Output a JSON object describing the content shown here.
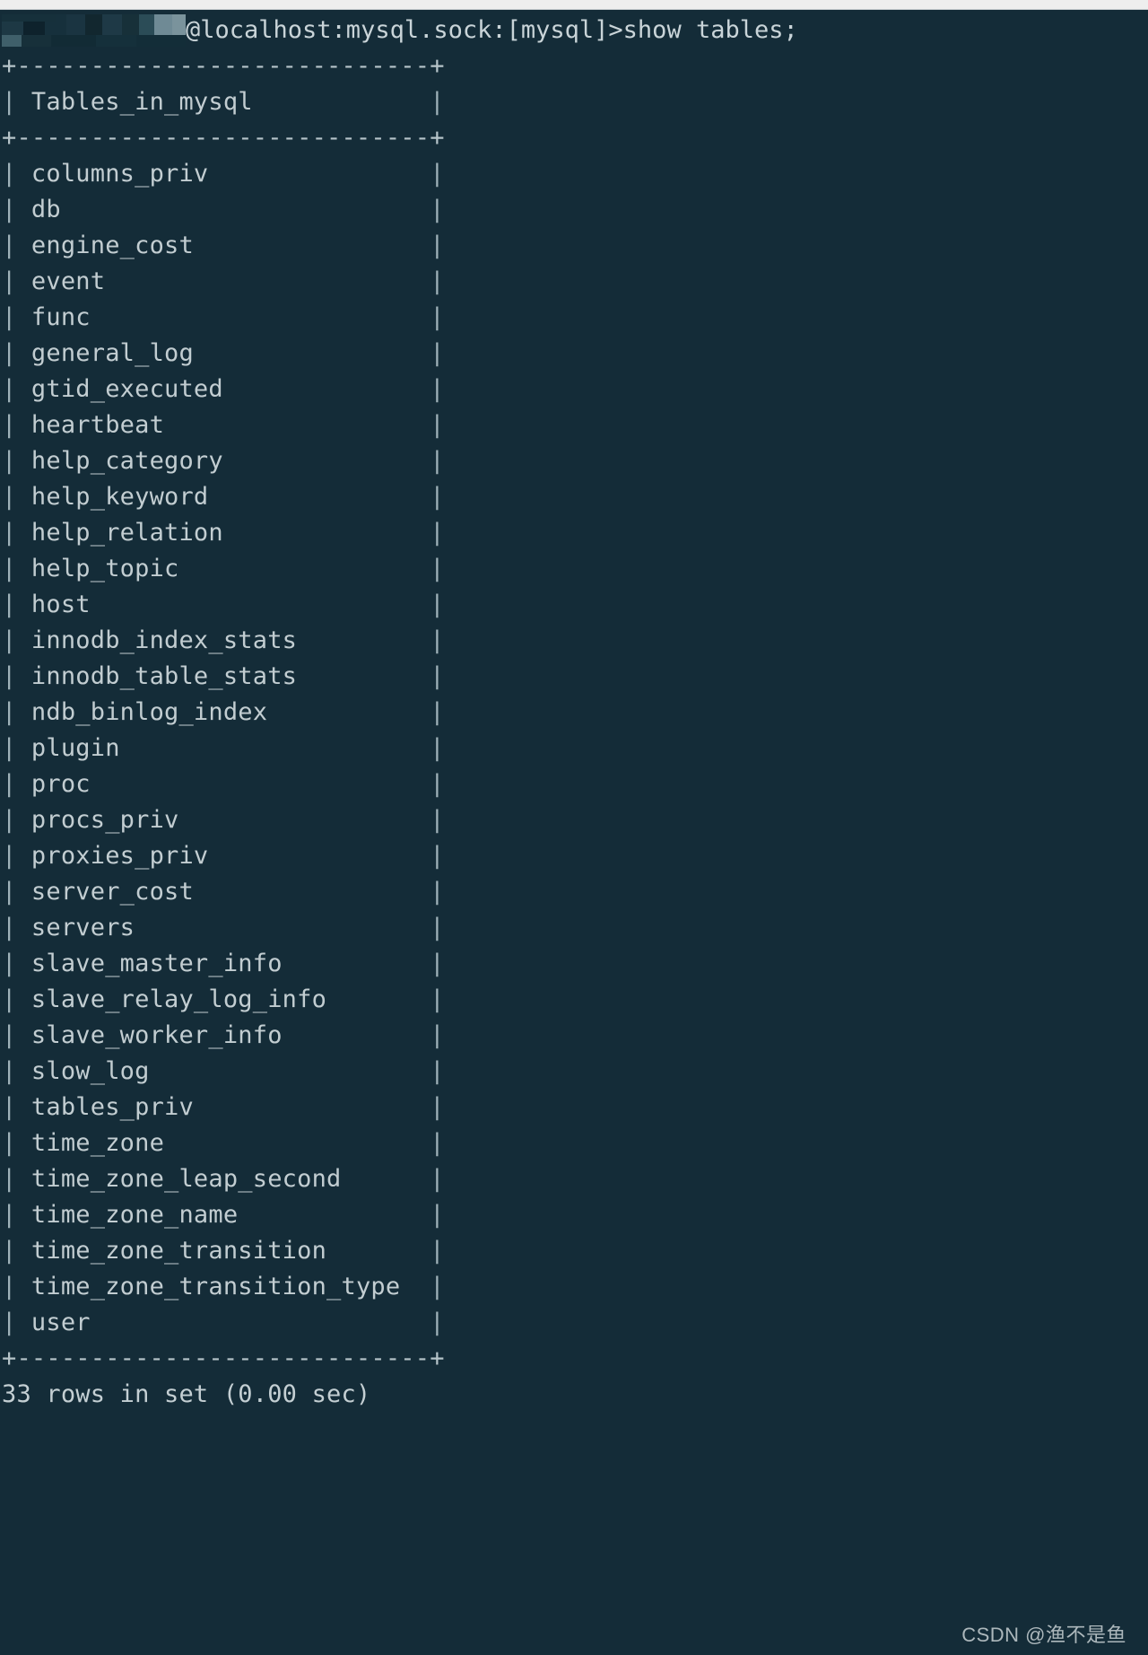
{
  "terminal": {
    "background_color": "#142c38",
    "text_color": "#c2cdd1",
    "prompt": {
      "redacted_user_label": "redacted-username",
      "host_and_session": "@localhost:mysql.sock:[mysql]>",
      "command": "show tables;"
    },
    "table": {
      "top_border": "+----------------------------+",
      "header_cell": "Tables_in_mysql",
      "header_separator": "+----------------------------+",
      "bottom_border": "+----------------------------+",
      "column_header": "Tables_in_mysql",
      "rows": [
        "columns_priv",
        "db",
        "engine_cost",
        "event",
        "func",
        "general_log",
        "gtid_executed",
        "heartbeat",
        "help_category",
        "help_keyword",
        "help_relation",
        "help_topic",
        "host",
        "innodb_index_stats",
        "innodb_table_stats",
        "ndb_binlog_index",
        "plugin",
        "proc",
        "procs_priv",
        "proxies_priv",
        "server_cost",
        "servers",
        "slave_master_info",
        "slave_relay_log_info",
        "slave_worker_info",
        "slow_log",
        "tables_priv",
        "time_zone",
        "time_zone_leap_second",
        "time_zone_name",
        "time_zone_transition",
        "time_zone_transition_type",
        "user"
      ]
    },
    "result_line": "33 rows in set (0.00 sec)",
    "row_count": 33,
    "elapsed": "0.00 sec"
  },
  "watermark": {
    "text": "CSDN @渔不是鱼"
  }
}
